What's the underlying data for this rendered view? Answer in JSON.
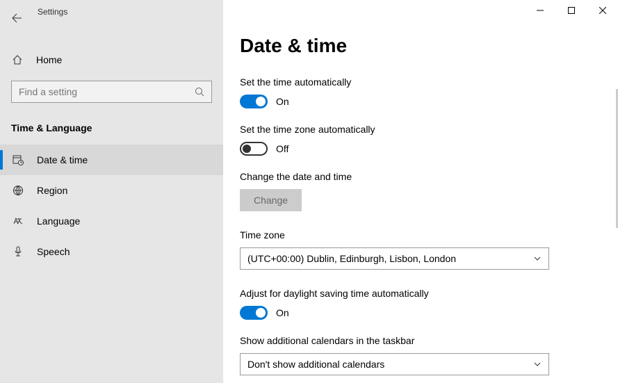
{
  "app": {
    "title": "Settings"
  },
  "sidebar": {
    "home_label": "Home",
    "search_placeholder": "Find a setting",
    "category": "Time & Language",
    "items": [
      {
        "label": "Date & time",
        "selected": true
      },
      {
        "label": "Region",
        "selected": false
      },
      {
        "label": "Language",
        "selected": false
      },
      {
        "label": "Speech",
        "selected": false
      }
    ]
  },
  "page": {
    "title": "Date & time",
    "set_time_auto_label": "Set the time automatically",
    "set_time_auto_state": "On",
    "set_tz_auto_label": "Set the time zone automatically",
    "set_tz_auto_state": "Off",
    "change_dt_label": "Change the date and time",
    "change_button": "Change",
    "timezone_label": "Time zone",
    "timezone_value": "(UTC+00:00) Dublin, Edinburgh, Lisbon, London",
    "dst_label": "Adjust for daylight saving time automatically",
    "dst_state": "On",
    "additional_cal_label": "Show additional calendars in the taskbar",
    "additional_cal_value": "Don't show additional calendars"
  }
}
